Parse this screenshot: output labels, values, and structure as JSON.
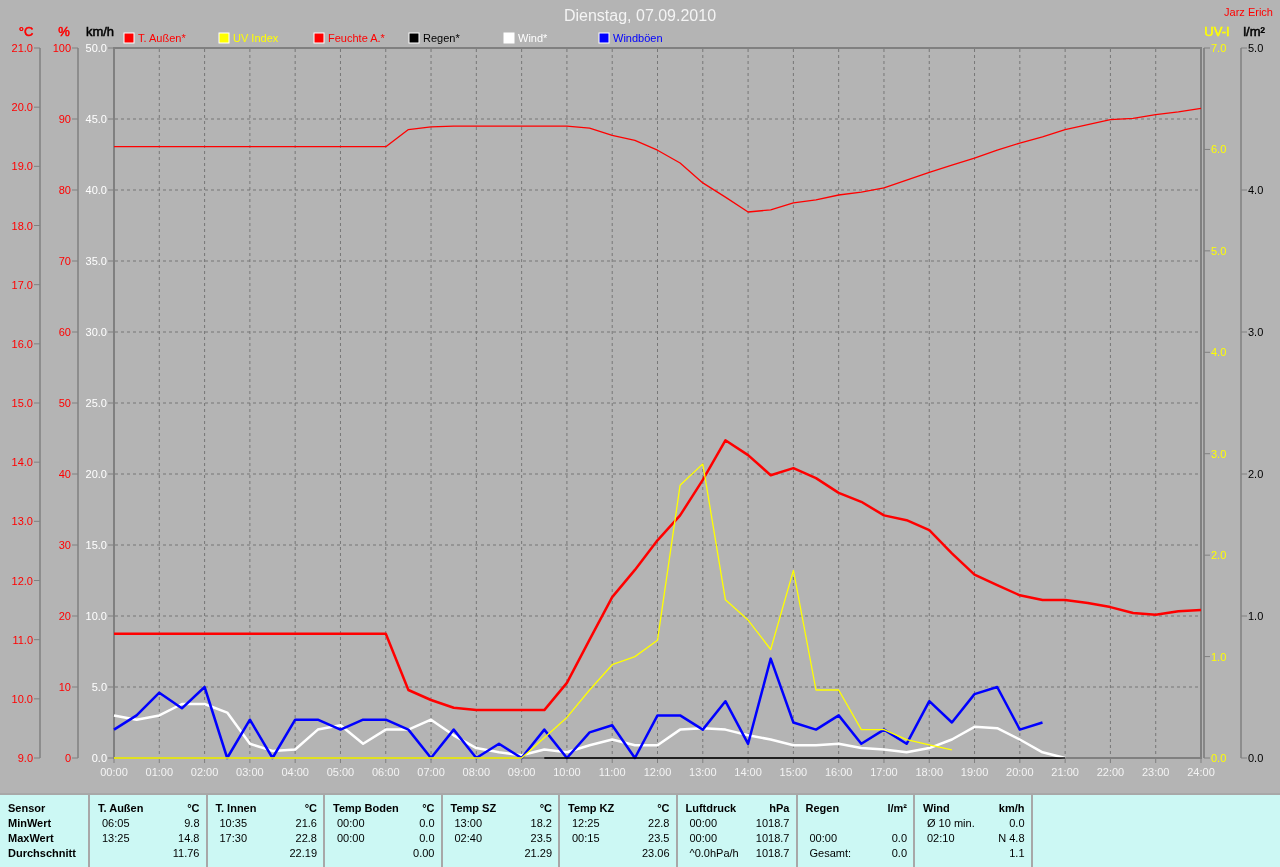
{
  "chart": {
    "title": "Dienstag, 07.09.2010",
    "owner": "Jarz Erich",
    "units": [
      {
        "text": "°C",
        "color": "#ff0000"
      },
      {
        "text": "%",
        "color": "#ff0000"
      },
      {
        "text": "km/h",
        "color": "#000000"
      }
    ],
    "chart_data": {
      "type": "line",
      "legend": "top",
      "grid": true,
      "xlim": [
        0,
        24
      ],
      "x": [
        0,
        0.5,
        1,
        1.5,
        2,
        2.5,
        3,
        3.5,
        4,
        4.5,
        5,
        5.5,
        6,
        6.5,
        7,
        7.5,
        8,
        8.5,
        9,
        9.5,
        10,
        10.5,
        11,
        11.5,
        12,
        12.5,
        13,
        13.5,
        14,
        14.5,
        15,
        15.5,
        16,
        16.5,
        17,
        17.5,
        18,
        18.5,
        19,
        19.5,
        20,
        20.5,
        21,
        21.5,
        22,
        22.5,
        23,
        23.5,
        24
      ],
      "xticks": [
        {
          "value": 0,
          "label": "00:00"
        },
        {
          "value": 1,
          "label": "01:00"
        },
        {
          "value": 2,
          "label": "02:00"
        },
        {
          "value": 3,
          "label": "03:00"
        },
        {
          "value": 4,
          "label": "04:00"
        },
        {
          "value": 5,
          "label": "05:00"
        },
        {
          "value": 6,
          "label": "06:00"
        },
        {
          "value": 7,
          "label": "07:00"
        },
        {
          "value": 8,
          "label": "08:00"
        },
        {
          "value": 9,
          "label": "09:00"
        },
        {
          "value": 10,
          "label": "10:00"
        },
        {
          "value": 11,
          "label": "11:00"
        },
        {
          "value": 12,
          "label": "12:00"
        },
        {
          "value": 13,
          "label": "13:00"
        },
        {
          "value": 14,
          "label": "14:00"
        },
        {
          "value": 15,
          "label": "15:00"
        },
        {
          "value": 16,
          "label": "16:00"
        },
        {
          "value": 17,
          "label": "17:00"
        },
        {
          "value": 18,
          "label": "18:00"
        },
        {
          "value": 19,
          "label": "19:00"
        },
        {
          "value": 20,
          "label": "20:00"
        },
        {
          "value": 21,
          "label": "21:00"
        },
        {
          "value": 22,
          "label": "22:00"
        },
        {
          "value": 23,
          "label": "23:00"
        },
        {
          "value": 24,
          "label": "24:00"
        }
      ],
      "ylim": [
        0,
        50
      ],
      "yticks": [
        {
          "value": 50,
          "label": "50.0"
        },
        {
          "value": 45,
          "label": "45.0"
        },
        {
          "value": 40,
          "label": "40.0"
        },
        {
          "value": 35,
          "label": "35.0"
        },
        {
          "value": 30,
          "label": "30.0"
        },
        {
          "value": 25,
          "label": "25.0"
        },
        {
          "value": 20,
          "label": "20.0"
        },
        {
          "value": 15,
          "label": "15.0"
        },
        {
          "value": 10,
          "label": "10.0"
        },
        {
          "value": 5,
          "label": "5.0"
        },
        {
          "value": 0,
          "label": "0.0"
        }
      ],
      "y2lim": [
        9,
        21
      ],
      "y2ticks": [
        {
          "value": 21,
          "label": "21.0"
        },
        {
          "value": 20,
          "label": "20.0"
        },
        {
          "value": 19,
          "label": "19.0"
        },
        {
          "value": 18,
          "label": "18.0"
        },
        {
          "value": 17,
          "label": "17.0"
        },
        {
          "value": 16,
          "label": "16.0"
        },
        {
          "value": 15,
          "label": "15.0"
        },
        {
          "value": 14,
          "label": "14.0"
        },
        {
          "value": 13,
          "label": "13.0"
        },
        {
          "value": 12,
          "label": "12.0"
        },
        {
          "value": 11,
          "label": "11.0"
        },
        {
          "value": 10,
          "label": "10.0"
        },
        {
          "value": 9,
          "label": "9.0"
        }
      ],
      "y3lim": [
        0,
        100
      ],
      "y3ticks": [
        {
          "value": 100,
          "label": "100"
        },
        {
          "value": 90,
          "label": "90"
        },
        {
          "value": 80,
          "label": "80"
        },
        {
          "value": 70,
          "label": "70"
        },
        {
          "value": 60,
          "label": "60"
        },
        {
          "value": 50,
          "label": "50"
        },
        {
          "value": 40,
          "label": "40"
        },
        {
          "value": 30,
          "label": "30"
        },
        {
          "value": 20,
          "label": "20"
        },
        {
          "value": 10,
          "label": "10"
        },
        {
          "value": 0,
          "label": "0"
        }
      ],
      "series": [
        {
          "name": "T. Außen*",
          "color": "#ff0000",
          "axis": "y2",
          "values": [
            11.1,
            11.1,
            11.1,
            11.1,
            11.1,
            11.1,
            11.1,
            11.1,
            11.1,
            11.1,
            11.1,
            11.1,
            11.1,
            10.15,
            9.98,
            9.85,
            9.81,
            9.81,
            9.81,
            9.81,
            10.27,
            11.0,
            11.72,
            12.18,
            12.68,
            13.1,
            13.7,
            14.37,
            14.12,
            13.78,
            13.9,
            13.73,
            13.48,
            13.33,
            13.1,
            13.02,
            12.85,
            12.46,
            12.1,
            11.92,
            11.75,
            11.67,
            11.67,
            11.62,
            11.55,
            11.45,
            11.42,
            11.48,
            11.5
          ]
        },
        {
          "name": "Feuchte A.*",
          "color": "#ff0000",
          "axis": "y3",
          "values": [
            86.1,
            86.1,
            86.1,
            86.1,
            86.1,
            86.1,
            86.1,
            86.1,
            86.1,
            86.1,
            86.1,
            86.1,
            86.1,
            88.5,
            88.9,
            89.0,
            89.0,
            89.0,
            89.0,
            89.0,
            89.0,
            88.7,
            87.7,
            87.0,
            85.6,
            83.8,
            81.0,
            79.0,
            76.9,
            77.2,
            78.2,
            78.6,
            79.3,
            79.7,
            80.3,
            81.4,
            82.5,
            83.5,
            84.5,
            85.6,
            86.6,
            87.5,
            88.5,
            89.2,
            89.9,
            90.1,
            90.6,
            91.0,
            91.5
          ]
        },
        {
          "name": "Wind*",
          "color": "#ffffff",
          "values": [
            3.0,
            2.7,
            3.0,
            3.8,
            3.8,
            3.2,
            1.0,
            0.5,
            0.6,
            2.0,
            2.3,
            1.0,
            2.0,
            2.0,
            2.7,
            1.6,
            0.7,
            0.4,
            0.2,
            0.6,
            0.4,
            0.9,
            1.3,
            0.9,
            0.9,
            2.0,
            2.1,
            2.0,
            1.6,
            1.3,
            0.9,
            0.9,
            1.0,
            0.7,
            0.6,
            0.4,
            0.7,
            1.3,
            2.2,
            2.1,
            1.3,
            0.4,
            0.0,
            null,
            null,
            null,
            null,
            null,
            null
          ]
        },
        {
          "name": "Windböen",
          "color": "#0000ff",
          "values": [
            2.0,
            3.0,
            4.6,
            3.5,
            5.0,
            0,
            2.7,
            0,
            2.7,
            2.7,
            2.0,
            2.7,
            2.7,
            2.0,
            0,
            2.0,
            0,
            1.0,
            0,
            2.0,
            0,
            1.8,
            2.3,
            0,
            3.0,
            3.0,
            2.0,
            4.0,
            1.0,
            7.0,
            2.5,
            2.0,
            3.0,
            1.0,
            2.0,
            1.0,
            4.0,
            2.5,
            4.5,
            5.0,
            2.0,
            2.5,
            null,
            null,
            null,
            null,
            null,
            null,
            null
          ]
        }
      ]
    }
  },
  "right_chart": {
    "units": [
      {
        "text": "UV-I",
        "color": "#ffff00"
      },
      {
        "text": "l/m²",
        "color": "#000000"
      }
    ],
    "chart_data": {
      "type": "line",
      "legend": "top",
      "xlim": [
        0,
        24
      ],
      "x": [
        0,
        0.5,
        1,
        1.5,
        2,
        2.5,
        3,
        3.5,
        4,
        4.5,
        5,
        5.5,
        6,
        6.5,
        7,
        7.5,
        8,
        8.5,
        9,
        9.5,
        10,
        10.5,
        11,
        11.5,
        12,
        12.5,
        13,
        13.5,
        14,
        14.5,
        15,
        15.5,
        16,
        16.5,
        17,
        17.5,
        18,
        18.5,
        19,
        19.5,
        20,
        20.5,
        21
      ],
      "ylim": [
        0,
        7
      ],
      "yticks": [
        {
          "value": 7,
          "label": "7.0"
        },
        {
          "value": 6,
          "label": "6.0"
        },
        {
          "value": 5,
          "label": "5.0"
        },
        {
          "value": 4,
          "label": "4.0"
        },
        {
          "value": 3,
          "label": "3.0"
        },
        {
          "value": 2,
          "label": "2.0"
        },
        {
          "value": 1,
          "label": "1.0"
        },
        {
          "value": 0,
          "label": "0.0"
        }
      ],
      "y2lim": [
        0,
        5
      ],
      "y2ticks": [
        {
          "value": 5,
          "label": "5.0"
        },
        {
          "value": 4,
          "label": "4.0"
        },
        {
          "value": 3,
          "label": "3.0"
        },
        {
          "value": 2,
          "label": "2.0"
        },
        {
          "value": 1,
          "label": "1.0"
        },
        {
          "value": 0,
          "label": "0.0"
        }
      ],
      "series": [
        {
          "name": "UV Index",
          "color": "#ffff00",
          "values": [
            0,
            0,
            0,
            0,
            0,
            0,
            0,
            0,
            0,
            0,
            0,
            0,
            0,
            0,
            0,
            0,
            0,
            0,
            0,
            0.2,
            0.4,
            0.67,
            0.92,
            1.0,
            1.16,
            2.69,
            2.9,
            1.56,
            1.36,
            1.07,
            1.85,
            0.67,
            0.67,
            0.28,
            0.28,
            0.18,
            0.13,
            0.08,
            null,
            null,
            null,
            null,
            null
          ]
        },
        {
          "name": "Regen*",
          "color": "#000000",
          "axis": "y2",
          "values": [
            null,
            null,
            null,
            null,
            null,
            null,
            null,
            null,
            null,
            null,
            null,
            null,
            null,
            null,
            null,
            null,
            null,
            null,
            null,
            0,
            0,
            0,
            0,
            0,
            0,
            0,
            0,
            0,
            0,
            0,
            0,
            0,
            0,
            0,
            0,
            0,
            0,
            0,
            0,
            0,
            0,
            0,
            0
          ]
        }
      ]
    }
  },
  "table": {
    "header": "Sensor",
    "row_labels": [
      "MinWert",
      "MaxWert",
      "Durchschnitt"
    ],
    "groups": [
      {
        "title": "T. Außen",
        "unit": "°C",
        "cells": [
          {
            "time": "06:05",
            "value": "9.8"
          },
          {
            "time": "13:25",
            "value": "14.8"
          },
          {
            "value": "11.76"
          }
        ]
      },
      {
        "title": "T. Innen",
        "unit": "°C",
        "cells": [
          {
            "time": "10:35",
            "value": "21.6"
          },
          {
            "time": "17:30",
            "value": "22.8"
          },
          {
            "value": "22.19"
          }
        ]
      },
      {
        "title": "Temp Boden",
        "unit": "°C",
        "cells": [
          {
            "time": "00:00",
            "value": "0.0"
          },
          {
            "time": "00:00",
            "value": "0.0"
          },
          {
            "value": "0.00"
          }
        ]
      },
      {
        "title": "Temp SZ",
        "unit": "°C",
        "cells": [
          {
            "time": "13:00",
            "value": "18.2"
          },
          {
            "time": "02:40",
            "value": "23.5"
          },
          {
            "value": "21.29"
          }
        ]
      },
      {
        "title": "Temp KZ",
        "unit": "°C",
        "cells": [
          {
            "time": "12:25",
            "value": "22.8"
          },
          {
            "time": "00:15",
            "value": "23.5"
          },
          {
            "value": "23.06"
          }
        ]
      },
      {
        "title": "Luftdruck",
        "unit": "hPa",
        "cells": [
          {
            "time": "00:00",
            "value": "1018.7"
          },
          {
            "time": "00:00",
            "value": "1018.7"
          },
          {
            "time": "^0.0hPa/h",
            "value": "1018.7"
          }
        ]
      },
      {
        "title": "Regen",
        "unit": "l/m²",
        "cells": [
          {},
          {
            "time": "00:00",
            "value": "0.0"
          },
          {
            "time": "Gesamt:",
            "value": "0.0"
          }
        ]
      },
      {
        "title": "Wind",
        "unit": "km/h",
        "cells": [
          {
            "time": "Ø 10 min.",
            "value": "0.0"
          },
          {
            "time": "02:10",
            "value": "N 4.8"
          },
          {
            "value": "1.1"
          }
        ]
      }
    ]
  }
}
